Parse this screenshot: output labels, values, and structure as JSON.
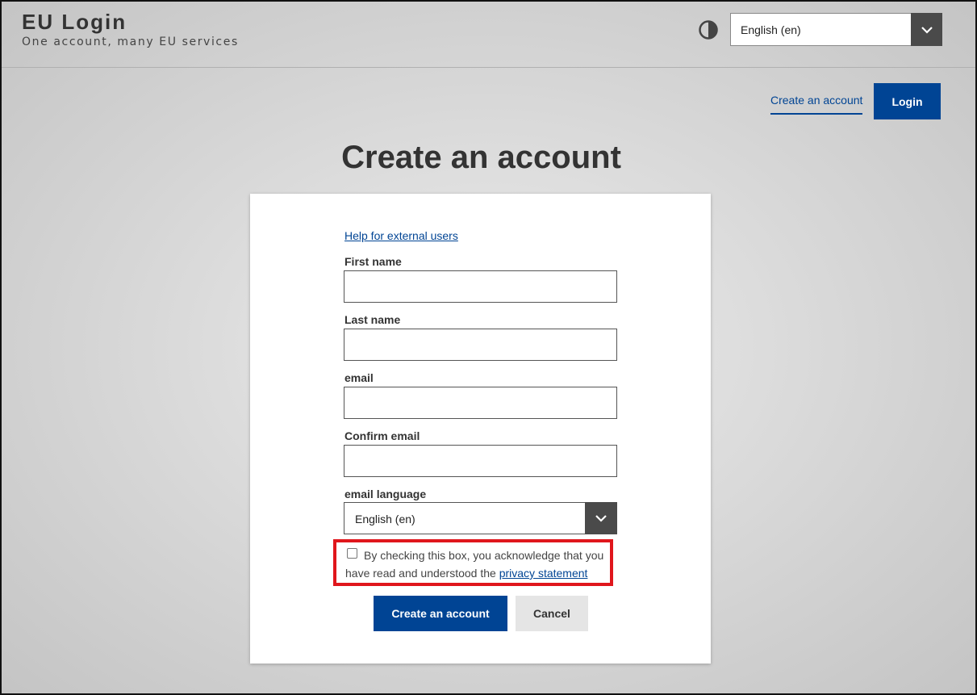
{
  "header": {
    "title": "EU Login",
    "subtitle": "One account, many EU services",
    "contrast_icon": "contrast-icon",
    "language_select": {
      "value": "English (en)",
      "icon": "chevron-down-icon"
    }
  },
  "nav": {
    "create_account_link": "Create an account",
    "login_button": "Login"
  },
  "page": {
    "title": "Create an account"
  },
  "form": {
    "help_link": "Help for external users",
    "first_name": {
      "label": "First name",
      "value": ""
    },
    "last_name": {
      "label": "Last name",
      "value": ""
    },
    "email": {
      "label": "email",
      "value": ""
    },
    "confirm_email": {
      "label": "Confirm email",
      "value": ""
    },
    "email_language": {
      "label": "email language",
      "value": "English (en)"
    },
    "consent": {
      "checked": false,
      "text": "By checking this box, you acknowledge that you have read and understood the ",
      "link": "privacy statement"
    },
    "submit_button": "Create an account",
    "cancel_button": "Cancel"
  },
  "colors": {
    "primary": "#004494",
    "highlight_border": "#e0161c",
    "dark_control": "#4a4a4a"
  }
}
